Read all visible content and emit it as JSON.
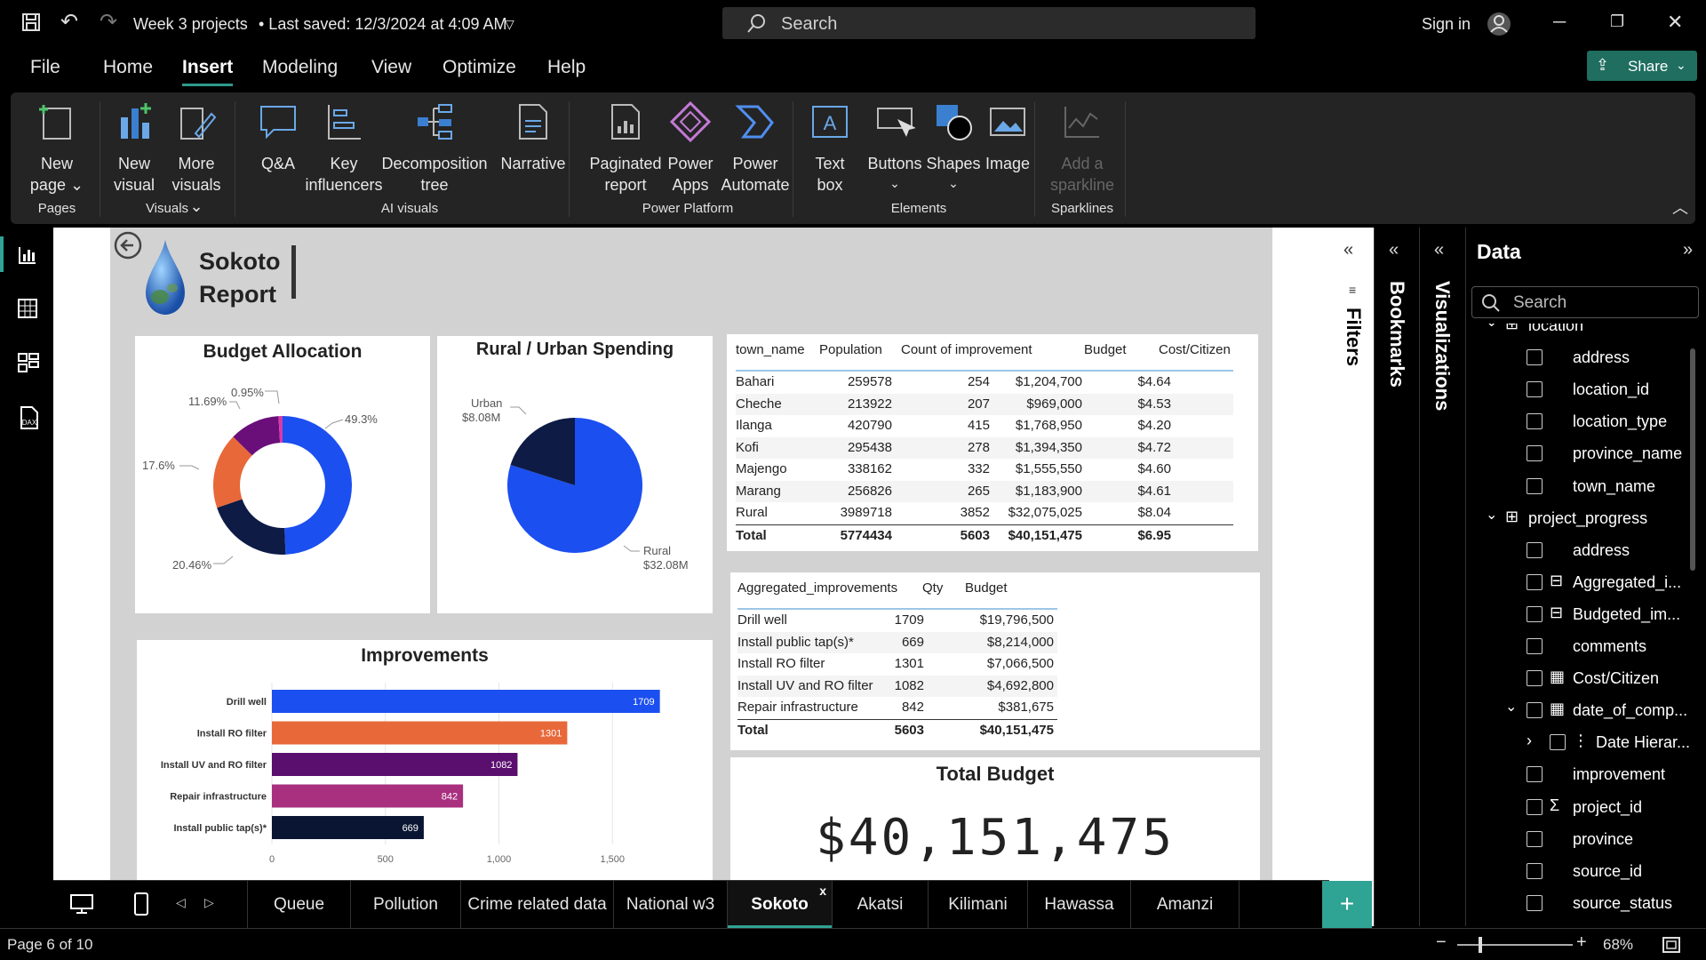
{
  "window": {
    "title": "Week 3 projects",
    "saved": "• Last saved: 12/3/2024 at 4:09 AM",
    "search_placeholder": "Search",
    "signin": "Sign in"
  },
  "menu": {
    "items": [
      "File",
      "Home",
      "Insert",
      "Modeling",
      "View",
      "Optimize",
      "Help"
    ],
    "active": "Insert",
    "share": "Share"
  },
  "ribbon": {
    "buttons": [
      {
        "l1": "New",
        "l2": "page",
        "caret": true
      },
      {
        "l1": "New",
        "l2": "visual"
      },
      {
        "l1": "More",
        "l2": "visuals",
        "caret": true
      },
      {
        "l1": "Q&A",
        "l2": ""
      },
      {
        "l1": "Key",
        "l2": "influencers"
      },
      {
        "l1": "Decomposition",
        "l2": "tree"
      },
      {
        "l1": "Narrative",
        "l2": ""
      },
      {
        "l1": "Paginated",
        "l2": "report"
      },
      {
        "l1": "Power",
        "l2": "Apps"
      },
      {
        "l1": "Power",
        "l2": "Automate"
      },
      {
        "l1": "Text",
        "l2": "box"
      },
      {
        "l1": "Buttons",
        "l2": "⌄"
      },
      {
        "l1": "Shapes",
        "l2": "⌄"
      },
      {
        "l1": "Image",
        "l2": ""
      },
      {
        "l1": "Add a",
        "l2": "sparkline"
      }
    ],
    "groups": [
      "Pages",
      "Visuals",
      "AI visuals",
      "Power Platform",
      "Elements",
      "Sparklines"
    ]
  },
  "report": {
    "title_line1": "Sokoto",
    "title_line2": "Report",
    "budget_allocation": {
      "title": "Budget Allocation",
      "labels": [
        "49.3%",
        "20.46%",
        "17.6%",
        "11.69%",
        "0.95%"
      ]
    },
    "rural_urban": {
      "title": "Rural / Urban Spending",
      "urban_label": "Urban",
      "urban_value": "$8.08M",
      "rural_label": "Rural",
      "rural_value": "$32.08M"
    },
    "town_table": {
      "headers": [
        "town_name",
        "Population",
        "Count of improvement",
        "Budget",
        "Cost/Citizen"
      ],
      "rows": [
        [
          "Bahari",
          "259578",
          "254",
          "$1,204,700",
          "$4.64"
        ],
        [
          "Cheche",
          "213922",
          "207",
          "$969,000",
          "$4.53"
        ],
        [
          "Ilanga",
          "420790",
          "415",
          "$1,768,950",
          "$4.20"
        ],
        [
          "Kofi",
          "295438",
          "278",
          "$1,394,350",
          "$4.72"
        ],
        [
          "Majengo",
          "338162",
          "332",
          "$1,555,550",
          "$4.60"
        ],
        [
          "Marang",
          "256826",
          "265",
          "$1,183,900",
          "$4.61"
        ],
        [
          "Rural",
          "3989718",
          "3852",
          "$32,075,025",
          "$8.04"
        ]
      ],
      "total": [
        "Total",
        "5774434",
        "5603",
        "$40,151,475",
        "$6.95"
      ]
    },
    "improvement_table": {
      "headers": [
        "Aggregated_improvements",
        "Qty",
        "Budget"
      ],
      "rows": [
        [
          "Drill well",
          "1709",
          "$19,796,500"
        ],
        [
          "Install public tap(s)*",
          "669",
          "$8,214,000"
        ],
        [
          "Install RO filter",
          "1301",
          "$7,066,500"
        ],
        [
          "Install UV and RO filter",
          "1082",
          "$4,692,800"
        ],
        [
          "Repair infrastructure",
          "842",
          "$381,675"
        ]
      ],
      "total": [
        "Total",
        "5603",
        "$40,151,475"
      ]
    },
    "improvements_chart": {
      "title": "Improvements",
      "ticks": [
        "0",
        "500",
        "1,000",
        "1,500"
      ]
    },
    "total_budget": {
      "title": "Total Budget",
      "value": "$40,151,475"
    }
  },
  "chart_data": [
    {
      "type": "pie",
      "title": "Budget Allocation",
      "donut": true,
      "values": [
        49.3,
        20.46,
        17.6,
        11.69,
        0.95
      ],
      "colors": [
        "#1b4ff0",
        "#0d1b45",
        "#e8683a",
        "#6a0f7a",
        "#d93aa8"
      ]
    },
    {
      "type": "pie",
      "title": "Rural / Urban Spending",
      "categories": [
        "Rural",
        "Urban"
      ],
      "values": [
        32.08,
        8.08
      ],
      "colors": [
        "#1b4ff0",
        "#0d1b45"
      ]
    },
    {
      "type": "bar",
      "title": "Improvements",
      "orientation": "horizontal",
      "categories": [
        "Drill well",
        "Install RO filter",
        "Install UV and RO filter",
        "Repair infrastructure",
        "Install public tap(s)*"
      ],
      "values": [
        1709,
        1301,
        1082,
        842,
        669
      ],
      "colors": [
        "#1b4ff0",
        "#e8683a",
        "#5a0e6e",
        "#a8307f",
        "#0a1533"
      ],
      "xlim": [
        0,
        2000
      ]
    }
  ],
  "panes": {
    "filters": "Filters",
    "bookmarks": "Bookmarks",
    "visualizations": "Visualizations",
    "data": "Data",
    "data_search": "Search"
  },
  "fields": [
    {
      "label": "location",
      "kind": "table",
      "indent": 0,
      "partial": true
    },
    {
      "label": "address",
      "kind": "field",
      "indent": 1
    },
    {
      "label": "location_id",
      "kind": "field",
      "indent": 1
    },
    {
      "label": "location_type",
      "kind": "field",
      "indent": 1
    },
    {
      "label": "province_name",
      "kind": "field",
      "indent": 1
    },
    {
      "label": "town_name",
      "kind": "field",
      "indent": 1
    },
    {
      "label": "project_progress",
      "kind": "table",
      "indent": 0
    },
    {
      "label": "address",
      "kind": "field",
      "indent": 1
    },
    {
      "label": "Aggregated_i...",
      "kind": "calc",
      "indent": 1
    },
    {
      "label": "Budgeted_im...",
      "kind": "calc",
      "indent": 1
    },
    {
      "label": "comments",
      "kind": "field",
      "indent": 1
    },
    {
      "label": "Cost/Citizen",
      "kind": "measure",
      "indent": 1
    },
    {
      "label": "date_of_comp...",
      "kind": "date",
      "indent": 1,
      "expand": true
    },
    {
      "label": "Date Hierar...",
      "kind": "hier",
      "indent": 2
    },
    {
      "label": "improvement",
      "kind": "field",
      "indent": 1
    },
    {
      "label": "project_id",
      "kind": "sigma",
      "indent": 1
    },
    {
      "label": "province",
      "kind": "field",
      "indent": 1
    },
    {
      "label": "source_id",
      "kind": "field",
      "indent": 1
    },
    {
      "label": "source_status",
      "kind": "field",
      "indent": 1
    }
  ],
  "tabs": [
    "Queue",
    "Pollution",
    "Crime related data",
    "National w3",
    "Sokoto",
    "Akatsi",
    "Kilimani",
    "Hawassa",
    "Amanzi"
  ],
  "active_tab": "Sokoto",
  "status": {
    "page": "Page 6 of 10",
    "zoom": "68%",
    "zoom_level": 0.68
  }
}
